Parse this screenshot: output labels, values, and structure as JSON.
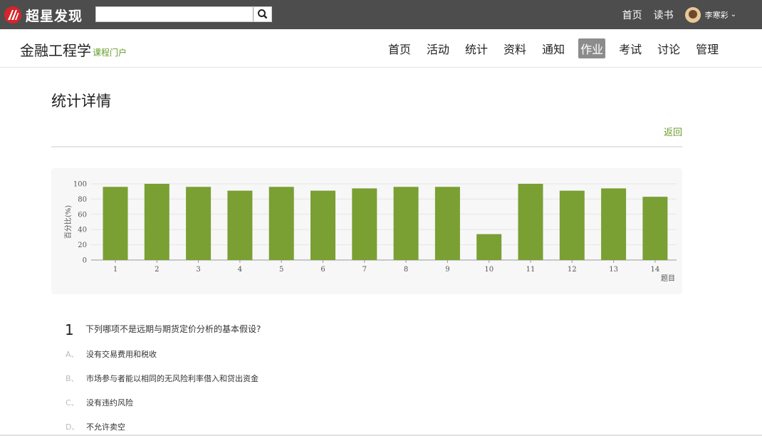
{
  "topbar": {
    "logo_text": "超星发现",
    "search_placeholder": "",
    "links": [
      "首页",
      "读书"
    ],
    "user_name": "李寒彩",
    "user_caret": "⌄"
  },
  "course": {
    "title": "金融工程学",
    "subtitle": "课程门户",
    "nav": [
      {
        "label": "首页",
        "active": false
      },
      {
        "label": "活动",
        "active": false
      },
      {
        "label": "统计",
        "active": false
      },
      {
        "label": "资料",
        "active": false
      },
      {
        "label": "通知",
        "active": false
      },
      {
        "label": "作业",
        "active": true
      },
      {
        "label": "考试",
        "active": false
      },
      {
        "label": "讨论",
        "active": false
      },
      {
        "label": "管理",
        "active": false
      }
    ]
  },
  "page": {
    "title": "统计详情",
    "back_label": "返回"
  },
  "colors": {
    "bar": "#7a9f33",
    "accent": "#6a9c2d",
    "topbar": "#4d4d4d"
  },
  "chart_data": {
    "type": "bar",
    "categories": [
      "1",
      "2",
      "3",
      "4",
      "5",
      "6",
      "7",
      "8",
      "9",
      "10",
      "11",
      "12",
      "13",
      "14"
    ],
    "values": [
      96,
      100,
      96,
      91,
      96,
      91,
      94,
      96,
      96,
      34,
      100,
      91,
      94,
      83
    ],
    "ylabel": "百分比(%)",
    "xlabel": "题目",
    "yticks": [
      "0",
      "20",
      "40",
      "60",
      "80",
      "100"
    ],
    "ylim": [
      0,
      100
    ],
    "grid": true
  },
  "question": {
    "number": "1",
    "text": "下列哪项不是远期与期货定价分析的基本假设?",
    "options": [
      {
        "letter": "A、",
        "text": "没有交易费用和税收"
      },
      {
        "letter": "B、",
        "text": "市场参与者能以相同的无风险利率借入和贷出资金"
      },
      {
        "letter": "C、",
        "text": "没有违约风险"
      },
      {
        "letter": "D、",
        "text": "不允许卖空"
      }
    ]
  }
}
